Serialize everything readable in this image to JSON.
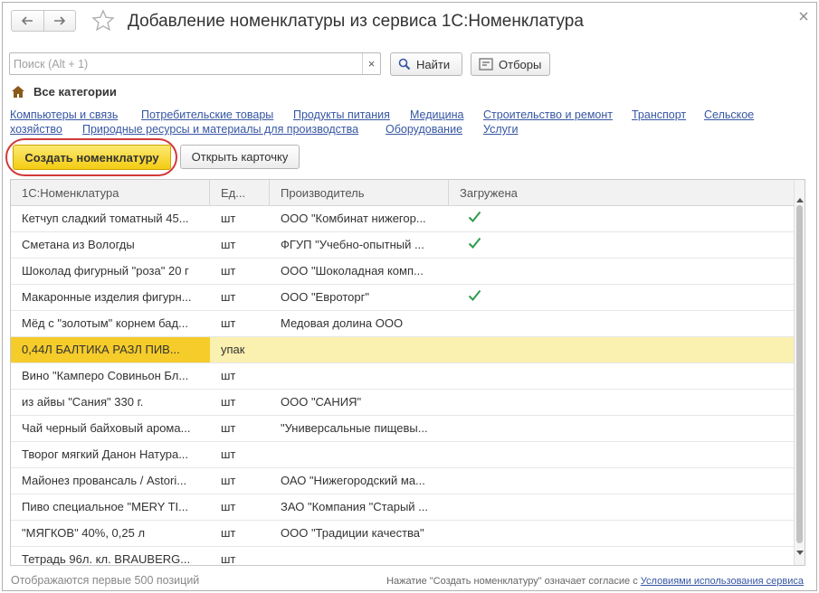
{
  "window": {
    "title": "Добавление номенклатуры из сервиса 1С:Номенклатура"
  },
  "search": {
    "placeholder": "Поиск (Alt + 1)",
    "value": "",
    "clear_label": "×",
    "find_label": "Найти",
    "filter_label": "Отборы"
  },
  "categories": {
    "all_label": "Все категории",
    "items": [
      "Компьютеры и связь",
      "Потребительские товары",
      "Продукты питания",
      "Медицина",
      "Строительство и ремонт",
      "Транспорт",
      "Сельское",
      "хозяйство",
      "Природные ресурсы и материалы для производства",
      "Оборудование",
      "Услуги"
    ]
  },
  "toolbar": {
    "create_label": "Создать номенклатуру",
    "open_label": "Открыть карточку"
  },
  "table": {
    "columns": [
      "1С:Номенклатура",
      "Ед...",
      "Производитель",
      "Загружена"
    ],
    "rows": [
      {
        "name": "Кетчуп сладкий томатный 45...",
        "unit": "шт",
        "maker": "ООО \"Комбинат нижегор...",
        "loaded": true
      },
      {
        "name": "Сметана из Вологды",
        "unit": "шт",
        "maker": "ФГУП \"Учебно-опытный ...",
        "loaded": true
      },
      {
        "name": "Шоколад фигурный \"роза\" 20 г",
        "unit": "шт",
        "maker": "ООО \"Шоколадная комп...",
        "loaded": false
      },
      {
        "name": "Макаронные изделия фигурн...",
        "unit": "шт",
        "maker": "ООО \"Евроторг\"",
        "loaded": true
      },
      {
        "name": "Мёд с \"золотым\" корнем бад...",
        "unit": "шт",
        "maker": "Медовая долина ООО",
        "loaded": false
      },
      {
        "name": "0,44Л БАЛТИКА РАЗЛ ПИВ...",
        "unit": "упак",
        "maker": "",
        "loaded": false,
        "selected": true
      },
      {
        "name": "Вино \"Камперо Совиньон Бл...",
        "unit": "шт",
        "maker": "",
        "loaded": false
      },
      {
        "name": "из айвы \"Сания\" 330 г.",
        "unit": "шт",
        "maker": "ООО \"САНИЯ\"",
        "loaded": false
      },
      {
        "name": "Чай черный байховый арома...",
        "unit": "шт",
        "maker": "\"Универсальные пищевы...",
        "loaded": false
      },
      {
        "name": "Творог мягкий Данон Натура...",
        "unit": "шт",
        "maker": "",
        "loaded": false
      },
      {
        "name": "Майонез провансаль / Astori...",
        "unit": "шт",
        "maker": "ОАО \"Нижегородский ма...",
        "loaded": false
      },
      {
        "name": "Пиво специальное \"MERY TI...",
        "unit": "шт",
        "maker": "ЗАО \"Компания \"Старый ...",
        "loaded": false
      },
      {
        "name": "\"МЯГКОВ\" 40%, 0,25 л",
        "unit": "шт",
        "maker": "ООО \"Традиции качества\"",
        "loaded": false
      },
      {
        "name": "Тетрадь 96л. кл. BRAUBERG...",
        "unit": "шт",
        "maker": "",
        "loaded": false
      }
    ]
  },
  "footer": {
    "count_text": "Отображаются первые 500 позиций",
    "notice_text": "Нажатие \"Создать номенклатуру\" означает согласие с ",
    "terms_link": "Условиями использования сервиса"
  },
  "colors": {
    "link": "#3656a3",
    "accent_yellow": "#f5cc2a",
    "selected_row": "#faf0b0",
    "check_green": "#2e9a4a",
    "highlight_ring": "#d23a3a"
  }
}
